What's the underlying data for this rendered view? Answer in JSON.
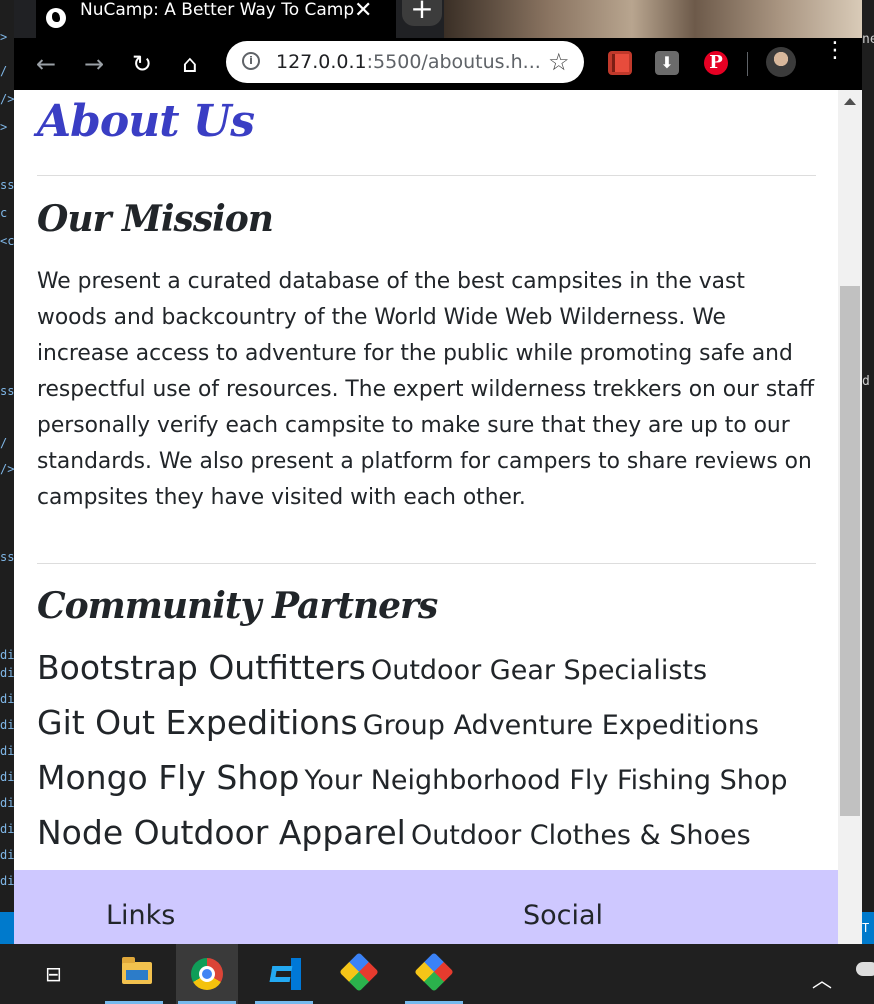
{
  "browser": {
    "tab_title": "NuCamp: A Better Way To Camp",
    "close_glyph": "✕",
    "new_tab_glyph": "+",
    "url_host": "127.0.0.1",
    "url_rest": ":5500/aboutus.h...",
    "back_glyph": "←",
    "forward_glyph": "→",
    "reload_glyph": "↻",
    "home_glyph": "⌂",
    "star_glyph": "☆",
    "info_glyph": "i",
    "pinterest_glyph": "P",
    "menu_glyph": "⋮"
  },
  "page": {
    "title": "About Us",
    "mission": {
      "heading": "Our Mission",
      "text": "We present a curated database of the best campsites in the vast woods and backcountry of the World Wide Web Wilderness. We increase access to adventure for the public while promoting safe and respectful use of resources. The expert wilderness trekkers on our staff personally verify each campsite to make sure that they are up to our standards. We also present a platform for campers to share reviews on campsites they have visited with each other."
    },
    "partners": {
      "heading": "Community Partners",
      "items": [
        {
          "name": "Bootstrap Outfitters",
          "desc": "Outdoor Gear Specialists"
        },
        {
          "name": "Git Out Expeditions",
          "desc": "Group Adventure Expeditions"
        },
        {
          "name": "Mongo Fly Shop",
          "desc": "Your Neighborhood Fly Fishing Shop"
        },
        {
          "name": "Node Outdoor Apparel",
          "desc": "Outdoor Clothes & Shoes"
        }
      ]
    },
    "footer": {
      "links_title": "Links",
      "social_title": "Social"
    }
  },
  "taskbar": {
    "task_view_glyph": "⊟",
    "tray_chevron": "︿"
  },
  "editor_fragments": {
    "left": [
      ">",
      "/",
      "/>",
      ">",
      "ss",
      "c",
      "<c",
      "ss",
      "/",
      "/>",
      "ss",
      "di",
      "di",
      "di",
      "di",
      "di",
      "di",
      "di",
      "di",
      "di",
      "di",
      "di"
    ],
    "right_top": "ne",
    "right_mid": "d",
    "right_bottom": "T"
  },
  "colors": {
    "title_blue": "#3a3ec4",
    "footer_bg": "#cec8ff",
    "text": "#212529"
  }
}
